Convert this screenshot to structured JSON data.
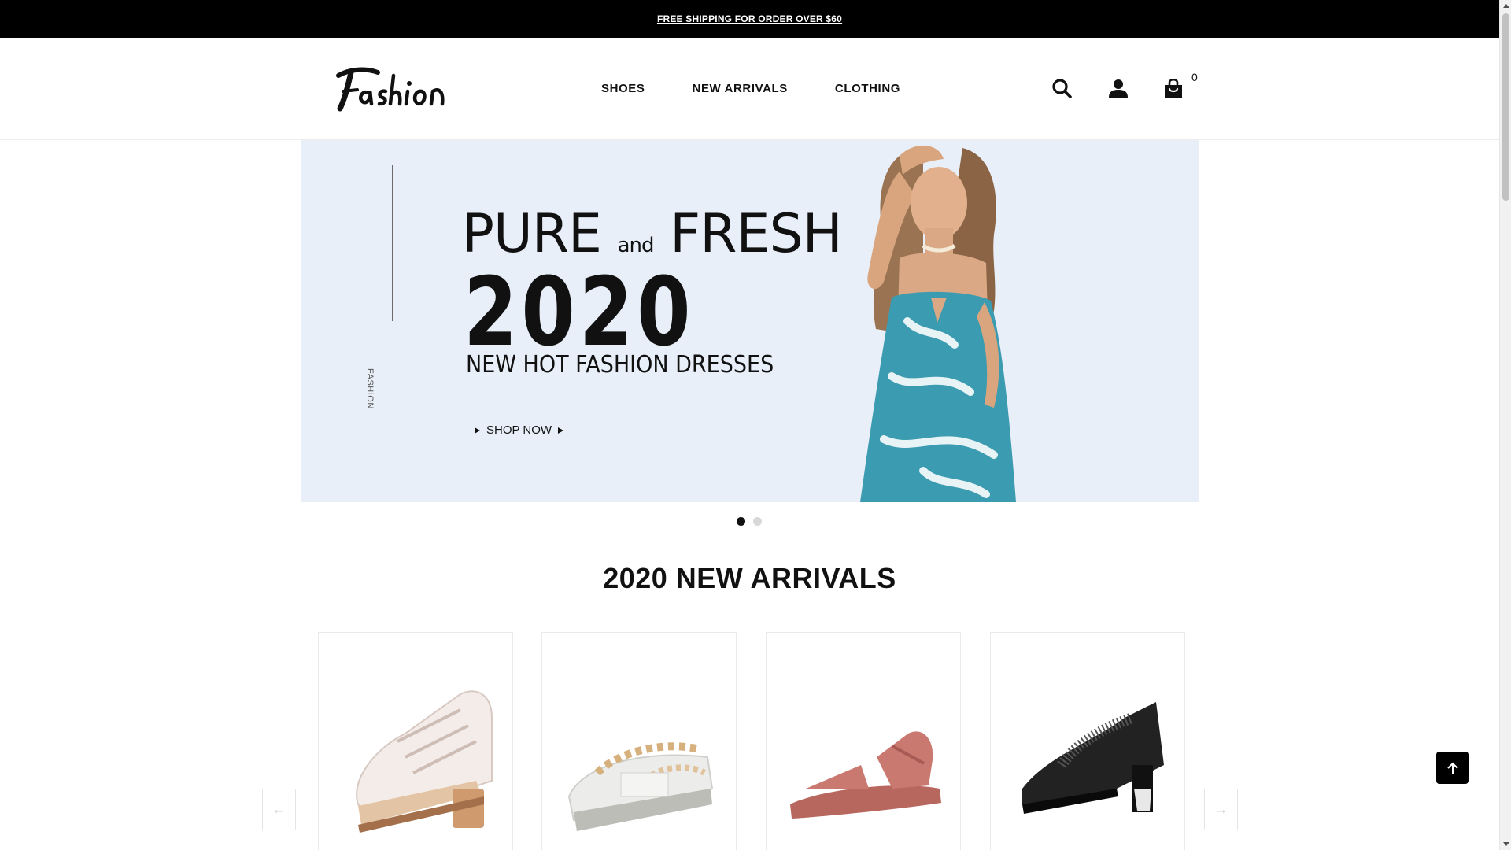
{
  "announcement": {
    "text": "FREE SHIPPING FOR ORDER OVER $60"
  },
  "header": {
    "logo_text": "Fashion",
    "nav": [
      {
        "label": "SHOES"
      },
      {
        "label": "NEW ARRIVALS"
      },
      {
        "label": "CLOTHING"
      }
    ],
    "icons": [
      "search-icon",
      "user-icon",
      "cart-icon"
    ],
    "cart_count": "0"
  },
  "hero": {
    "side_label": "FASHION",
    "title_left": "PURE",
    "title_and": "and",
    "title_right": "FRESH",
    "year": "2020",
    "subtitle": "NEW HOT FASHION DRESSES",
    "cta": "SHOP NOW",
    "slides": 2,
    "active_slide": 1
  },
  "section": {
    "title": "2020 NEW ARRIVALS"
  },
  "products": [
    {
      "name": "white-lace-up-heeled-sandal"
    },
    {
      "name": "pearl-strap-platform-sandal"
    },
    {
      "name": "pink-velcro-flat-sandal"
    },
    {
      "name": "black-mesh-heeled-sandal"
    }
  ],
  "slider": {
    "prev": "←",
    "next": "→"
  },
  "colors": {
    "topbar": "#000000",
    "hero_bg": "#e8eff9",
    "dress": "#3b9bb0"
  }
}
